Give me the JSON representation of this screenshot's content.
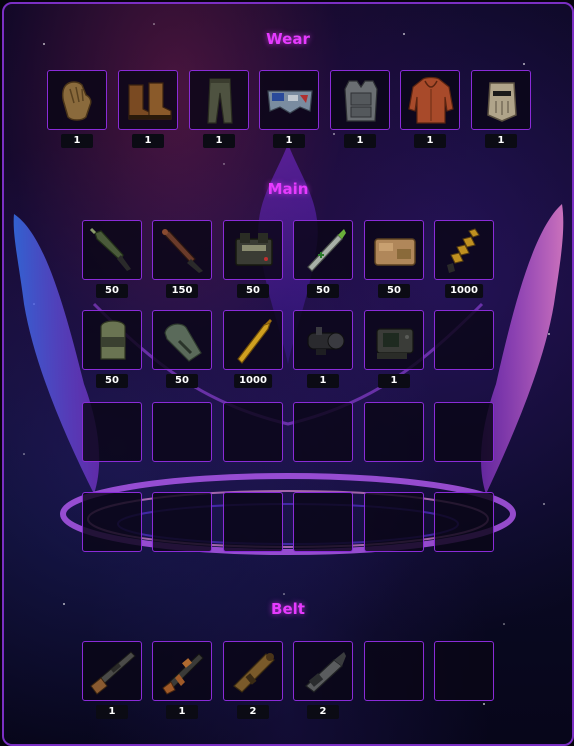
{
  "sections": {
    "wear": {
      "title": "Wear",
      "items": [
        {
          "icon": "gloves-icon",
          "qty": "1"
        },
        {
          "icon": "boots-icon",
          "qty": "1"
        },
        {
          "icon": "pants-icon",
          "qty": "1"
        },
        {
          "icon": "roadsign-kilt-icon",
          "qty": "1"
        },
        {
          "icon": "armor-vest-icon",
          "qty": "1"
        },
        {
          "icon": "hoodie-icon",
          "qty": "1"
        },
        {
          "icon": "facemask-icon",
          "qty": "1"
        }
      ]
    },
    "main": {
      "title": "Main",
      "items": [
        {
          "icon": "rocket-icon",
          "qty": "50"
        },
        {
          "icon": "incendiary-rocket-icon",
          "qty": "150"
        },
        {
          "icon": "c4-explosive-icon",
          "qty": "50"
        },
        {
          "icon": "smoke-rocket-icon",
          "qty": "50"
        },
        {
          "icon": "satchel-charge-icon",
          "qty": "50"
        },
        {
          "icon": "rifle-ammo-icon",
          "qty": "1000"
        },
        {
          "icon": "grenade-shell-icon",
          "qty": "50"
        },
        {
          "icon": "grenade-shell-icon",
          "qty": "50"
        },
        {
          "icon": "rifle-bullet-icon",
          "qty": "1000"
        },
        {
          "icon": "scope-attachment-icon",
          "qty": "1"
        },
        {
          "icon": "holo-sight-icon",
          "qty": "1"
        },
        {
          "icon": "",
          "qty": ""
        },
        {
          "icon": "",
          "qty": ""
        },
        {
          "icon": "",
          "qty": ""
        },
        {
          "icon": "",
          "qty": ""
        },
        {
          "icon": "",
          "qty": ""
        },
        {
          "icon": "",
          "qty": ""
        },
        {
          "icon": "",
          "qty": ""
        },
        {
          "icon": "",
          "qty": ""
        },
        {
          "icon": "",
          "qty": ""
        },
        {
          "icon": "",
          "qty": ""
        },
        {
          "icon": "",
          "qty": ""
        },
        {
          "icon": "",
          "qty": ""
        },
        {
          "icon": "",
          "qty": ""
        }
      ]
    },
    "belt": {
      "title": "Belt",
      "items": [
        {
          "icon": "bolt-rifle-icon",
          "qty": "1"
        },
        {
          "icon": "assault-rifle-icon",
          "qty": "1"
        },
        {
          "icon": "rocket-launcher-icon",
          "qty": "2"
        },
        {
          "icon": "minigun-icon",
          "qty": "2"
        },
        {
          "icon": "",
          "qty": ""
        },
        {
          "icon": "",
          "qty": ""
        }
      ]
    }
  },
  "colors": {
    "accent": "#e63bff",
    "slot_border": "#8a2bd8",
    "panel_border": "#7b2fc4"
  }
}
